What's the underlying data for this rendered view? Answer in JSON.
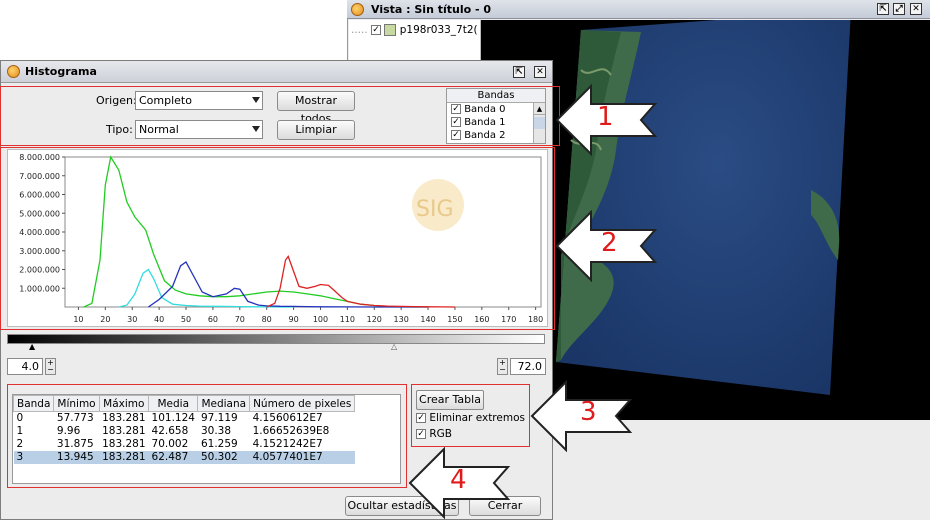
{
  "vista": {
    "title": "Vista : Sin título - 0",
    "layer": "p198r033_7t2("
  },
  "histogram": {
    "title": "Histograma",
    "origen_label": "Origen:",
    "origen_value": "Completo",
    "tipo_label": "Tipo:",
    "tipo_value": "Normal",
    "show_all_button": "Mostrar todos",
    "clear_button": "Limpiar",
    "bands_header": "Bandas",
    "bands": [
      "Banda 0",
      "Banda 1",
      "Banda 2"
    ],
    "min_value": "4.0",
    "max_value": "72.0",
    "create_table_button": "Crear Tabla",
    "eliminate_extremes_label": "Eliminar extremos",
    "rgb_label": "RGB",
    "hide_stats_button": "Ocultar estadísticas",
    "close_button": "Cerrar",
    "watermark": "SIG",
    "table": {
      "headers": [
        "Banda",
        "Mínimo",
        "Máximo",
        "Media",
        "Mediana",
        "Número de pixeles"
      ],
      "rows": [
        [
          "0",
          "57.773",
          "183.281",
          "101.124",
          "97.119",
          "4.1560612E7"
        ],
        [
          "1",
          "9.96",
          "183.281",
          "42.658",
          "30.38",
          "1.66652639E8"
        ],
        [
          "2",
          "31.875",
          "183.281",
          "70.002",
          "61.259",
          "4.1521242E7"
        ],
        [
          "3",
          "13.945",
          "183.281",
          "62.487",
          "50.302",
          "4.0577401E7"
        ]
      ]
    }
  },
  "callouts": [
    "1",
    "2",
    "3",
    "4"
  ],
  "chart_data": {
    "type": "line",
    "ylim": [
      0,
      8000000
    ],
    "xlim": [
      5,
      182
    ],
    "y_ticks": [
      "1.000.000",
      "2.000.000",
      "3.000.000",
      "4.000.000",
      "5.000.000",
      "6.000.000",
      "7.000.000",
      "8.000.000"
    ],
    "x_ticks": [
      "10",
      "20",
      "30",
      "40",
      "50",
      "60",
      "70",
      "80",
      "90",
      "100",
      "110",
      "120",
      "130",
      "140",
      "150",
      "160",
      "170",
      "180"
    ],
    "colors": {
      "green": "#22cc22",
      "cyan": "#33dddd",
      "blue": "#2233bb",
      "red": "#dd2222"
    },
    "series": [
      {
        "color": "green",
        "x": [
          12,
          15,
          18,
          20,
          22,
          25,
          28,
          31,
          35,
          38,
          42,
          46,
          50,
          55,
          60,
          65,
          70,
          75,
          80,
          85,
          90,
          95,
          100,
          105,
          110,
          115,
          120,
          125,
          130,
          135,
          140
        ],
        "values": [
          0,
          200000,
          2500000,
          6500000,
          8000000,
          7300000,
          5600000,
          4800000,
          4100000,
          2800000,
          1400000,
          900000,
          700000,
          600000,
          550000,
          550000,
          600000,
          700000,
          800000,
          850000,
          800000,
          700000,
          600000,
          450000,
          300000,
          150000,
          80000,
          30000,
          10000,
          0,
          0
        ]
      },
      {
        "color": "cyan",
        "x": [
          25,
          28,
          31,
          34,
          36,
          38,
          41,
          45,
          50,
          55,
          60,
          65,
          70,
          75,
          80,
          85,
          90
        ],
        "values": [
          0,
          100000,
          700000,
          1800000,
          2000000,
          1500000,
          500000,
          150000,
          80000,
          50000,
          40000,
          30000,
          20000,
          10000,
          5000,
          0,
          0
        ]
      },
      {
        "color": "blue",
        "x": [
          36,
          40,
          45,
          48,
          50,
          53,
          56,
          60,
          65,
          68,
          70,
          73,
          77,
          80,
          85,
          90,
          95,
          100,
          110,
          120,
          130,
          140
        ],
        "values": [
          0,
          400000,
          1100000,
          2200000,
          2400000,
          1600000,
          800000,
          550000,
          700000,
          1000000,
          950000,
          300000,
          100000,
          60000,
          40000,
          30000,
          20000,
          10000,
          5000,
          0,
          0,
          0
        ]
      },
      {
        "color": "red",
        "x": [
          80,
          83,
          85,
          87,
          88,
          90,
          92,
          95,
          98,
          100,
          103,
          105,
          108,
          110,
          115,
          120,
          125,
          130,
          135,
          140,
          145,
          150
        ],
        "values": [
          0,
          200000,
          1000000,
          2500000,
          2700000,
          1900000,
          1100000,
          1000000,
          1100000,
          1200000,
          1150000,
          900000,
          500000,
          300000,
          150000,
          80000,
          50000,
          30000,
          20000,
          10000,
          5000,
          0
        ]
      }
    ]
  }
}
